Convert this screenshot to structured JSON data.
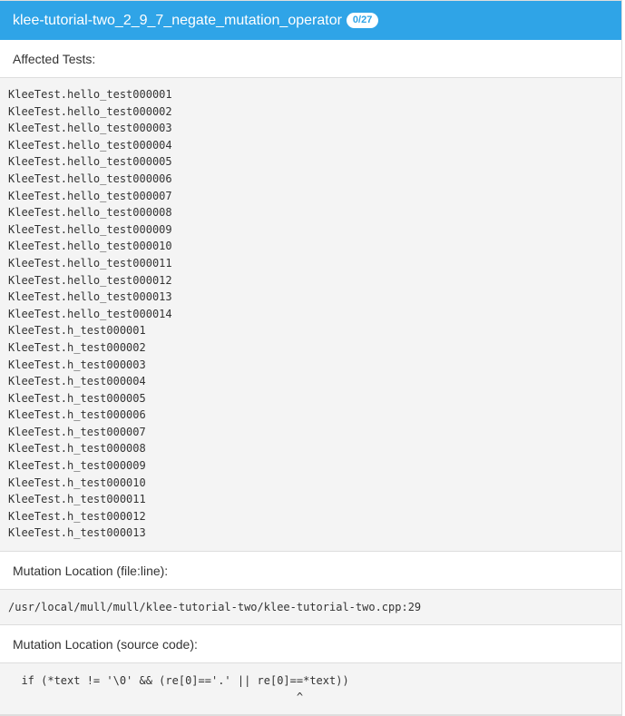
{
  "header": {
    "title": "klee-tutorial-two_2_9_7_negate_mutation_operator",
    "badge": "0/27"
  },
  "affected_tests": {
    "label": "Affected Tests:",
    "items": [
      "KleeTest.hello_test000001",
      "KleeTest.hello_test000002",
      "KleeTest.hello_test000003",
      "KleeTest.hello_test000004",
      "KleeTest.hello_test000005",
      "KleeTest.hello_test000006",
      "KleeTest.hello_test000007",
      "KleeTest.hello_test000008",
      "KleeTest.hello_test000009",
      "KleeTest.hello_test000010",
      "KleeTest.hello_test000011",
      "KleeTest.hello_test000012",
      "KleeTest.hello_test000013",
      "KleeTest.hello_test000014",
      "KleeTest.h_test000001",
      "KleeTest.h_test000002",
      "KleeTest.h_test000003",
      "KleeTest.h_test000004",
      "KleeTest.h_test000005",
      "KleeTest.h_test000006",
      "KleeTest.h_test000007",
      "KleeTest.h_test000008",
      "KleeTest.h_test000009",
      "KleeTest.h_test000010",
      "KleeTest.h_test000011",
      "KleeTest.h_test000012",
      "KleeTest.h_test000013"
    ]
  },
  "file_location": {
    "label": "Mutation Location (file:line):",
    "value": "/usr/local/mull/mull/klee-tutorial-two/klee-tutorial-two.cpp:29"
  },
  "source_location": {
    "label": "Mutation Location (source code):",
    "code_line": "  if (*text != '\\0' && (re[0]=='.' || re[0]==*text))",
    "caret_line": "                                            ^"
  }
}
